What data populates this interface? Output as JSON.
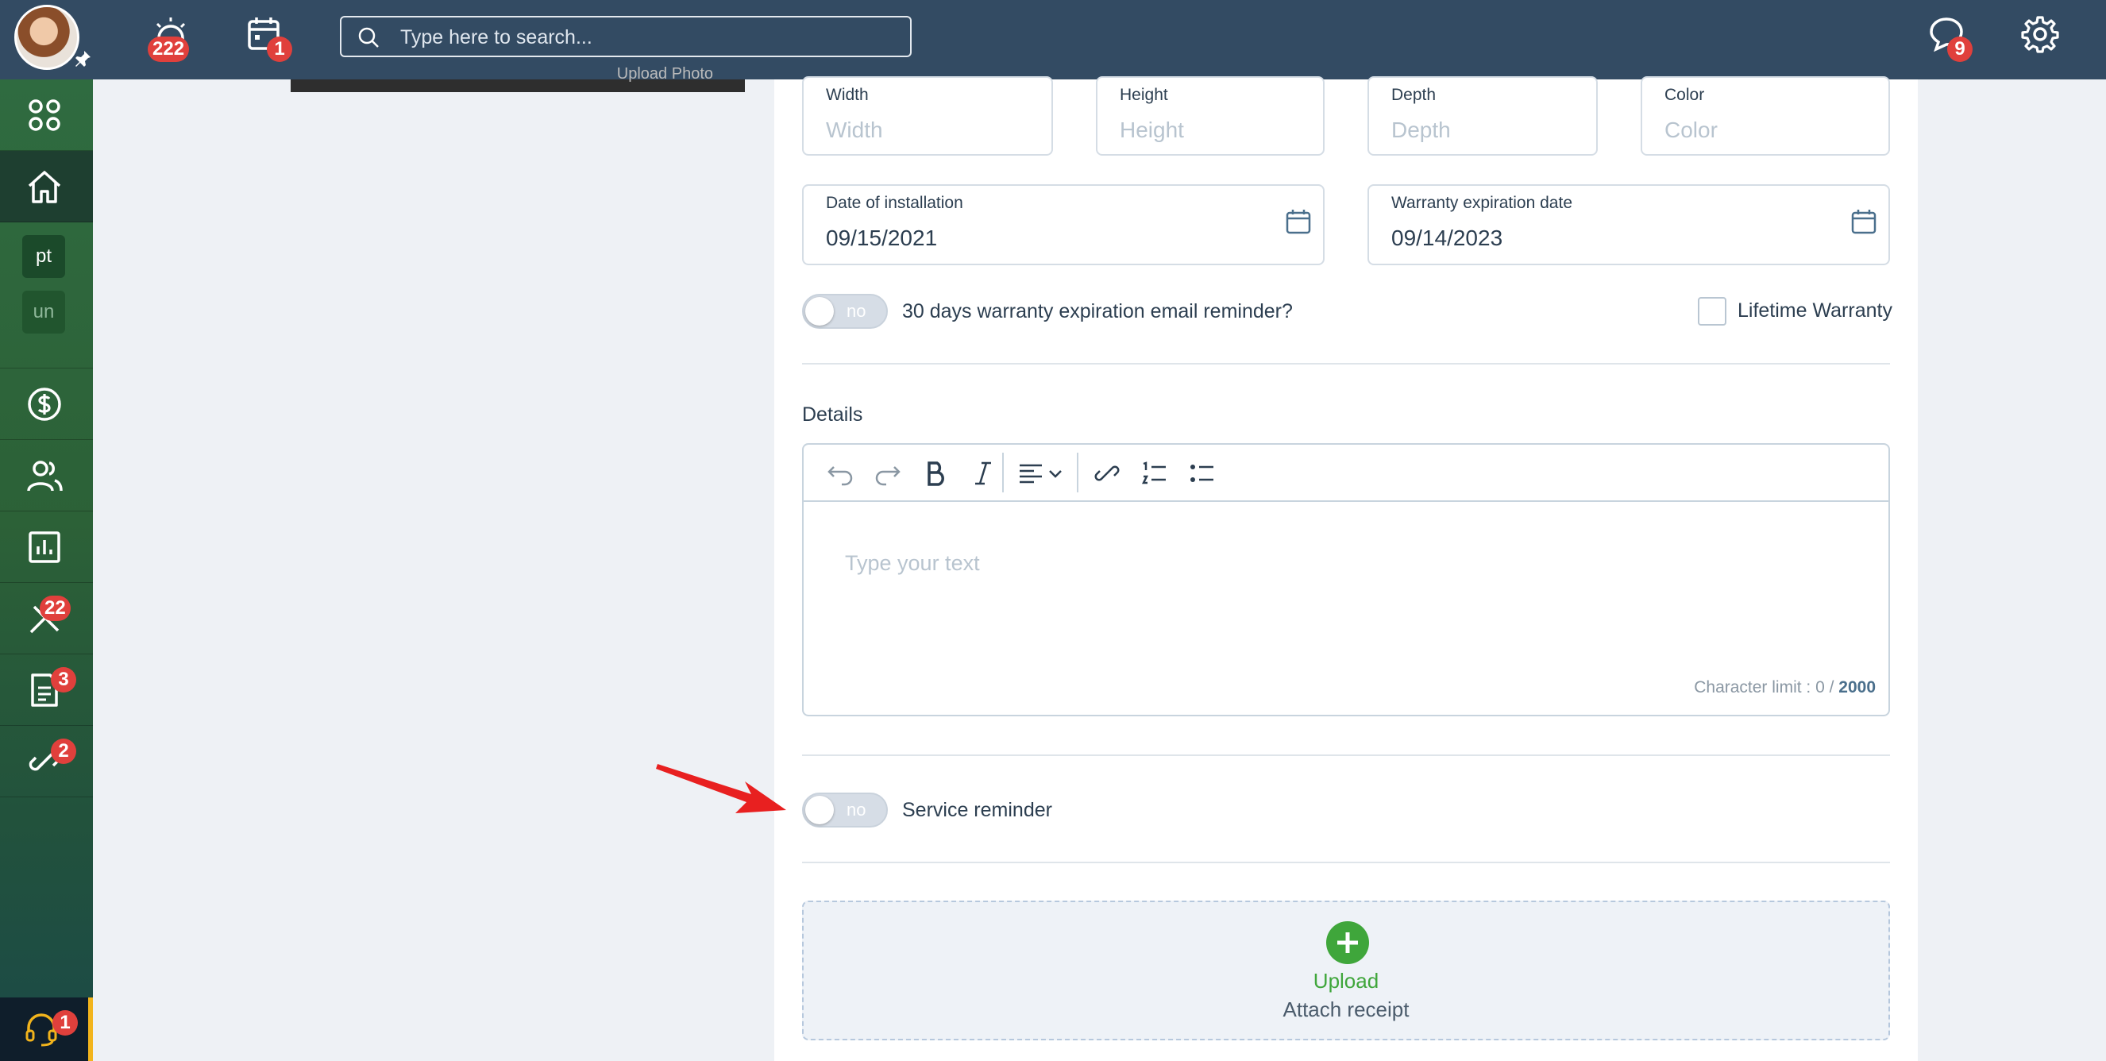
{
  "topbar": {
    "alarm_badge": "222",
    "calendar_badge": "1",
    "search_placeholder": "Type here to search...",
    "chat_badge": "9"
  },
  "sidebar": {
    "workspaces": [
      "pt",
      "un"
    ],
    "jobs_badge": "22",
    "documents_badge": "3",
    "links_badge": "2",
    "help_badge": "1"
  },
  "background_panel": {
    "partial_text": "Upload Photo"
  },
  "form": {
    "width": {
      "label": "Width",
      "placeholder": "Width"
    },
    "height": {
      "label": "Height",
      "placeholder": "Height"
    },
    "depth": {
      "label": "Depth",
      "placeholder": "Depth"
    },
    "color": {
      "label": "Color",
      "placeholder": "Color"
    },
    "installation": {
      "label": "Date of installation",
      "value": "09/15/2021"
    },
    "warranty": {
      "label": "Warranty expiration date",
      "value": "09/14/2023"
    },
    "warranty_reminder": {
      "toggle": "no",
      "label": "30 days warranty expiration email reminder?"
    },
    "lifetime_warranty": "Lifetime Warranty",
    "details": {
      "heading": "Details",
      "placeholder": "Type your text",
      "char_limit_prefix": "Character limit : 0 / ",
      "char_limit_max": "2000"
    },
    "service_reminder": {
      "toggle": "no",
      "label": "Service reminder"
    },
    "upload": {
      "title": "Upload",
      "subtitle": "Attach receipt"
    }
  },
  "colors": {
    "topbar": "#334b63",
    "sidebar": "#2c6137",
    "badge": "#e0403c",
    "upload_green": "#3fa63b",
    "arrow_red": "#e82020"
  }
}
